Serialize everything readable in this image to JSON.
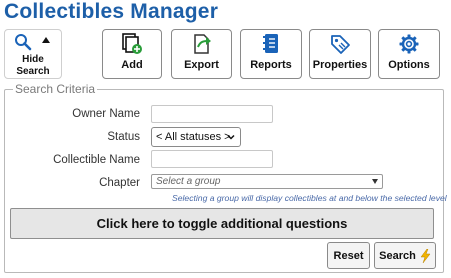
{
  "app": {
    "title": "Collectibles Manager"
  },
  "toolbar": {
    "hide_search": {
      "line1": "Hide",
      "line2": "Search"
    },
    "add": "Add",
    "export": "Export",
    "reports": "Reports",
    "properties": "Properties",
    "options": "Options"
  },
  "search": {
    "legend": "Search Criteria",
    "owner_name_label": "Owner Name",
    "owner_name_value": "",
    "status_label": "Status",
    "status_value": "< All statuses >",
    "collectible_name_label": "Collectible Name",
    "collectible_name_value": "",
    "chapter_label": "Chapter",
    "chapter_placeholder": "Select a group",
    "chapter_hint": "Selecting a group will display collectibles at and below the selected level",
    "toggle_label": "Click here to toggle additional questions",
    "reset_label": "Reset",
    "search_label": "Search"
  },
  "colors": {
    "title": "#1d5fa8",
    "icon_blue": "#1a63b8",
    "add_badge": "#2a9d3a",
    "search_bolt": "#f2b400",
    "hint_text": "#4a6aa8"
  },
  "icons": {
    "hide_search": [
      "magnifier-icon",
      "caret-up-icon"
    ],
    "add": "add-document-icon",
    "export": "export-document-icon",
    "reports": "report-book-icon",
    "properties": "tag-icon",
    "options": "gear-icon",
    "search": "lightning-icon"
  }
}
